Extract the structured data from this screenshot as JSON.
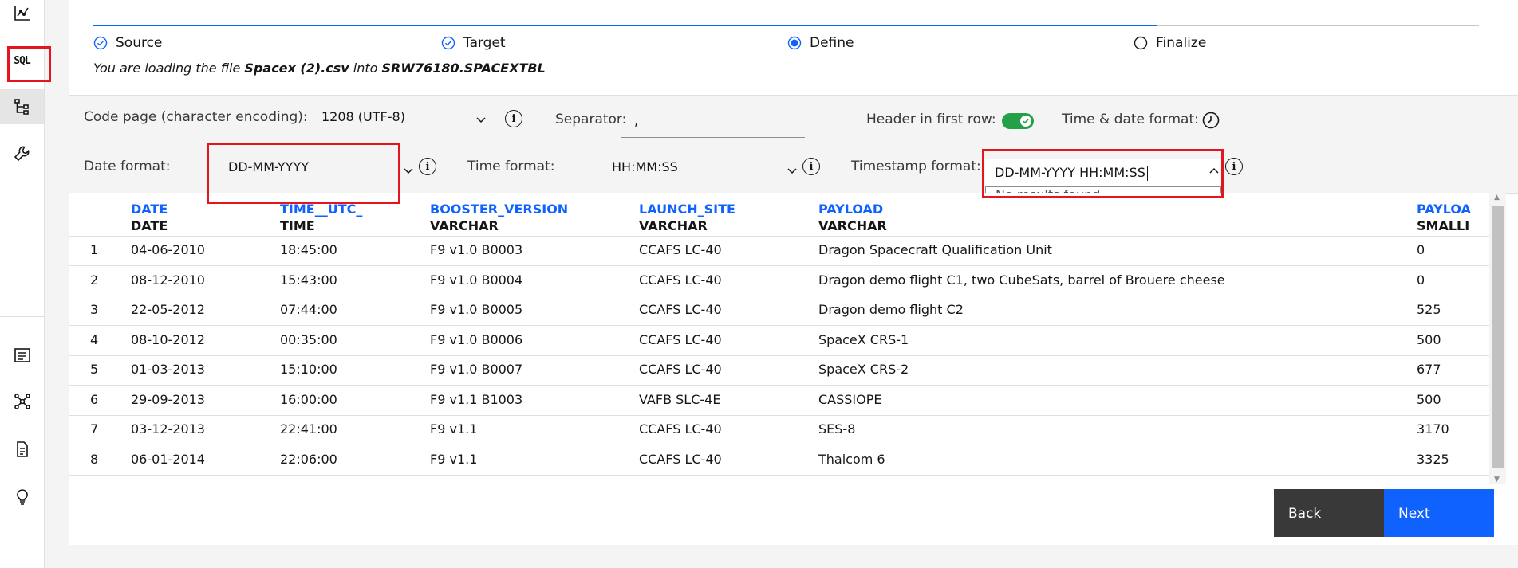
{
  "sidebar": {
    "sql_label": "SQL"
  },
  "steps": [
    {
      "label": "Source",
      "state": "complete"
    },
    {
      "label": "Target",
      "state": "complete"
    },
    {
      "label": "Define",
      "state": "current"
    },
    {
      "label": "Finalize",
      "state": "incomplete"
    }
  ],
  "loading": {
    "prefix": "You are loading the file ",
    "file": "Spacex (2).csv",
    "middle": " into ",
    "target": "SRW76180.SPACEXTBL"
  },
  "settings": {
    "code_page_label": "Code page (character encoding):",
    "code_page_value": "1208 (UTF-8)",
    "separator_label": "Separator:",
    "separator_value": ",",
    "header_label": "Header in first row:",
    "header_on": true,
    "time_date_label": "Time & date format:",
    "date_format_label": "Date format:",
    "date_format_value": "DD-MM-YYYY",
    "time_format_label": "Time format:",
    "time_format_value": "HH:MM:SS",
    "timestamp_label": "Timestamp format:",
    "timestamp_value": "DD-MM-YYYY HH:MM:SS",
    "timestamp_menu_text": "No results found"
  },
  "table": {
    "columns": [
      {
        "name": "DATE",
        "type": "DATE"
      },
      {
        "name": "TIME__UTC_",
        "type": "TIME"
      },
      {
        "name": "BOOSTER_VERSION",
        "type": "VARCHAR"
      },
      {
        "name": "LAUNCH_SITE",
        "type": "VARCHAR"
      },
      {
        "name": "PAYLOAD",
        "type": "VARCHAR"
      },
      {
        "name": "PAYLOA",
        "type": "SMALLI"
      }
    ],
    "rows": [
      [
        "1",
        "04-06-2010",
        "18:45:00",
        "F9 v1.0  B0003",
        "CCAFS LC-40",
        "Dragon Spacecraft Qualification Unit",
        "0"
      ],
      [
        "2",
        "08-12-2010",
        "15:43:00",
        "F9 v1.0  B0004",
        "CCAFS LC-40",
        "Dragon demo flight C1, two CubeSats, barrel of Brouere cheese",
        "0"
      ],
      [
        "3",
        "22-05-2012",
        "07:44:00",
        "F9 v1.0  B0005",
        "CCAFS LC-40",
        "Dragon demo flight C2",
        "525"
      ],
      [
        "4",
        "08-10-2012",
        "00:35:00",
        "F9 v1.0  B0006",
        "CCAFS LC-40",
        "SpaceX CRS-1",
        "500"
      ],
      [
        "5",
        "01-03-2013",
        "15:10:00",
        "F9 v1.0  B0007",
        "CCAFS LC-40",
        "SpaceX CRS-2",
        "677"
      ],
      [
        "6",
        "29-09-2013",
        "16:00:00",
        "F9 v1.1  B1003",
        "VAFB SLC-4E",
        "CASSIOPE",
        "500"
      ],
      [
        "7",
        "03-12-2013",
        "22:41:00",
        "F9 v1.1",
        "CCAFS LC-40",
        "SES-8",
        "3170"
      ],
      [
        "8",
        "06-01-2014",
        "22:06:00",
        "F9 v1.1",
        "CCAFS LC-40",
        "Thaicom 6",
        "3325"
      ]
    ]
  },
  "buttons": {
    "back": "Back",
    "next": "Next"
  },
  "colors": {
    "accent": "#0f62fe",
    "highlight": "#e4151f",
    "toggle_on": "#24a148"
  }
}
